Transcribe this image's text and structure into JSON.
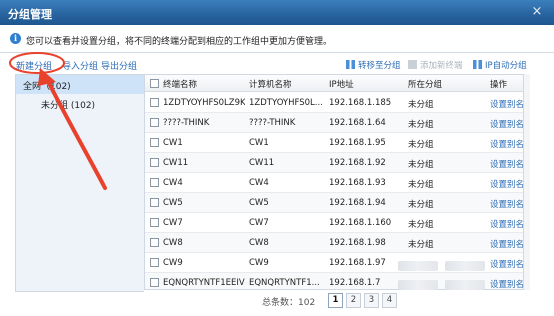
{
  "window": {
    "title": "分组管理",
    "close_label": "×"
  },
  "info": {
    "icon": "info-icon",
    "text": "您可以查看并设置分组，将不同的终端分配到相应的工作组中更加方便管理。"
  },
  "toolbar": {
    "new_group": "新建分组",
    "import_group": "导入分组",
    "export_group": "导出分组",
    "move_to_group": "转移至分组",
    "add_new_terminal": "添加新终端",
    "ip_auto_group": "IP自动分组"
  },
  "tree": {
    "all": "全网（102)",
    "ungrouped": "未分组 (102)"
  },
  "table": {
    "headers": {
      "name": "终端名称",
      "computer": "计算机名称",
      "ip": "IP地址",
      "group": "所在分组",
      "action": "操作"
    },
    "rows": [
      {
        "name": "1ZDTYOYHFS0LZ9K",
        "computer": "1ZDTYOYHFS0L...",
        "ip": "192.168.1.185",
        "group": "未分组",
        "action": "设置别名"
      },
      {
        "name": "????-THINK",
        "computer": "????-THINK",
        "ip": "192.168.1.64",
        "group": "未分组",
        "action": "设置别名"
      },
      {
        "name": "CW1",
        "computer": "CW1",
        "ip": "192.168.1.95",
        "group": "未分组",
        "action": "设置别名"
      },
      {
        "name": "CW11",
        "computer": "CW11",
        "ip": "192.168.1.92",
        "group": "未分组",
        "action": "设置别名"
      },
      {
        "name": "CW4",
        "computer": "CW4",
        "ip": "192.168.1.93",
        "group": "未分组",
        "action": "设置别名"
      },
      {
        "name": "CW5",
        "computer": "CW5",
        "ip": "192.168.1.94",
        "group": "未分组",
        "action": "设置别名"
      },
      {
        "name": "CW7",
        "computer": "CW7",
        "ip": "192.168.1.160",
        "group": "未分组",
        "action": "设置别名"
      },
      {
        "name": "CW8",
        "computer": "CW8",
        "ip": "192.168.1.98",
        "group": "未分组",
        "action": "设置别名"
      },
      {
        "name": "CW9",
        "computer": "CW9",
        "ip": "192.168.1.97",
        "group": "",
        "action": "设置别名"
      },
      {
        "name": "EQNQRTYNTF1EEIV",
        "computer": "EQNQRTYNTF1...",
        "ip": "192.168.1.7",
        "group": "",
        "action": "设置别名"
      }
    ]
  },
  "footer": {
    "total": "总条数：102",
    "pages": [
      "1",
      "2",
      "3",
      "4"
    ]
  },
  "colors": {
    "title_bar": "#27639e",
    "link": "#2c6cb4",
    "annotation": "#e8412c"
  }
}
